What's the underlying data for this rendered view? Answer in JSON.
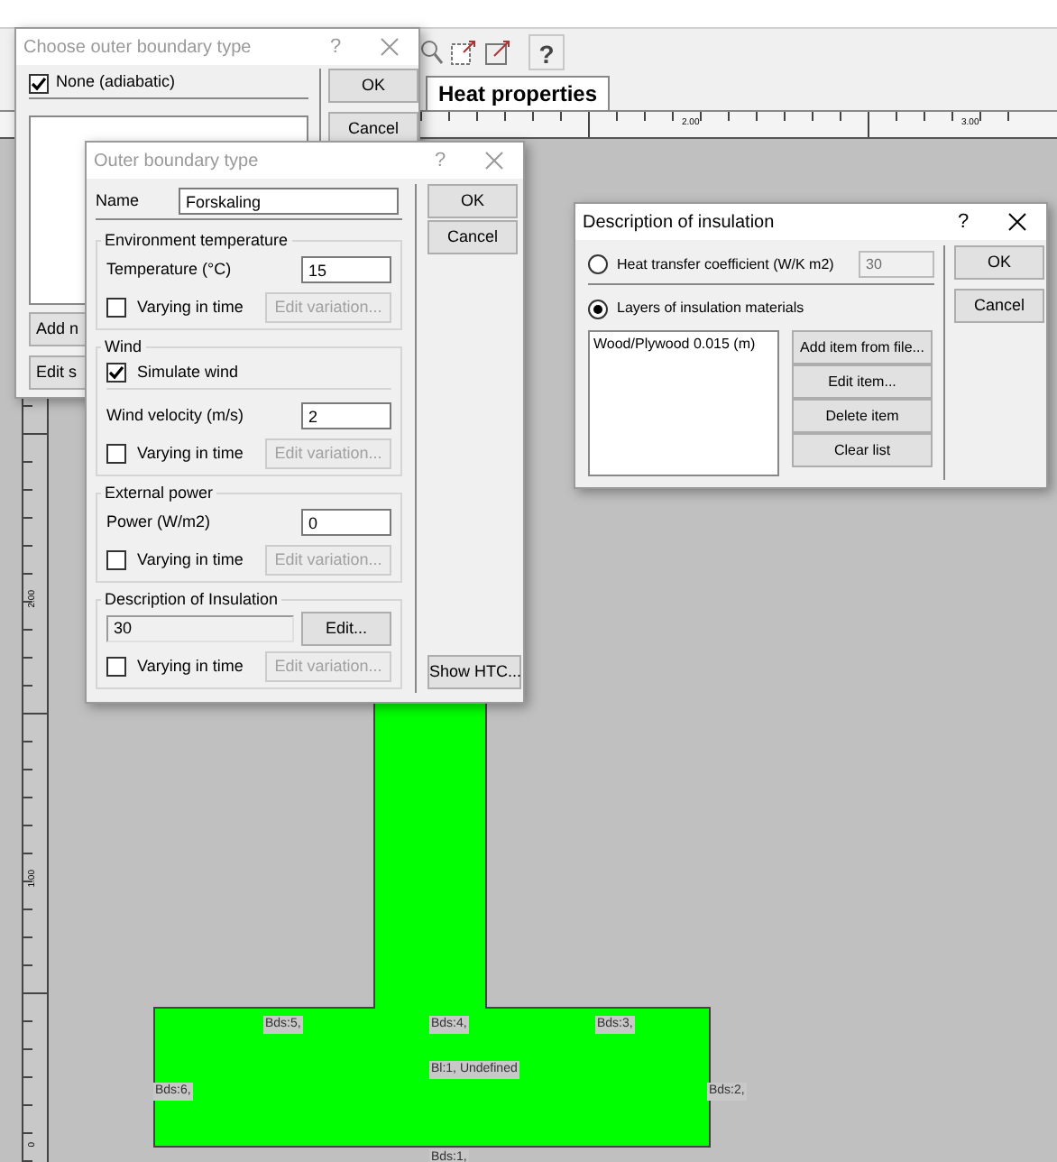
{
  "toolbar": {
    "help_button": "?"
  },
  "tabs": [
    {
      "label": "Heat properties",
      "selected": true
    }
  ],
  "horizontal_ruler": {
    "labels": [
      "2.00",
      "3.00"
    ]
  },
  "vertical_ruler": {
    "labels": [
      "2.00",
      "1.00",
      "0"
    ]
  },
  "geometry": {
    "labels": [
      {
        "text": "Bds:5,"
      },
      {
        "text": "Bds:4,"
      },
      {
        "text": "Bds:3,"
      },
      {
        "text": "Bl:1, Undefined"
      },
      {
        "text": "Bds:6,"
      },
      {
        "text": "Bds:2,"
      },
      {
        "text": "Bds:1,"
      }
    ]
  },
  "choose_dialog": {
    "title": "Choose outer boundary type",
    "help": "?",
    "active": false,
    "option": {
      "label": "None (adiabatic)",
      "checked": true
    },
    "buttons": [
      "OK",
      "Cancel"
    ],
    "bottom_buttons": [
      "Add n",
      "Edit s"
    ]
  },
  "outer_dialog": {
    "title": "Outer boundary type",
    "help": "?",
    "active": false,
    "name": {
      "label": "Name",
      "value": "Forskaling"
    },
    "groups": [
      {
        "title": "Environment temperature",
        "rows": [
          {
            "kind": "field",
            "label": "Temperature (°C)",
            "value": "15"
          },
          {
            "kind": "varying",
            "label": "Varying in time",
            "checked": false,
            "button": "Edit variation...",
            "disabled": true
          }
        ]
      },
      {
        "title": "Wind",
        "rows": [
          {
            "kind": "checkbox",
            "label": "Simulate wind",
            "checked": true
          },
          {
            "kind": "field",
            "label": "Wind velocity (m/s)",
            "value": "2"
          },
          {
            "kind": "varying",
            "label": "Varying in time",
            "checked": false,
            "button": "Edit variation...",
            "disabled": true
          }
        ]
      },
      {
        "title": "External power",
        "rows": [
          {
            "kind": "field",
            "label": "Power (W/m2)",
            "value": "0"
          },
          {
            "kind": "varying",
            "label": "Varying in time",
            "checked": false,
            "button": "Edit variation...",
            "disabled": true
          }
        ]
      },
      {
        "title": "Description of Insulation",
        "rows": [
          {
            "kind": "readout",
            "value": "30",
            "button": "Edit..."
          },
          {
            "kind": "varying",
            "label": "Varying in time",
            "checked": false,
            "button": "Edit variation...",
            "disabled": true
          }
        ]
      }
    ],
    "buttons": [
      "OK",
      "Cancel"
    ],
    "bottom_button": "Show HTC..."
  },
  "insulation_dialog": {
    "title": "Description of insulation",
    "help": "?",
    "active": true,
    "options": [
      {
        "label": "Heat transfer coefficient (W/K m2)",
        "selected": false,
        "value": "30"
      },
      {
        "label": "Layers of insulation materials",
        "selected": true
      }
    ],
    "list": [
      "Wood/Plywood 0.015 (m)"
    ],
    "list_buttons": [
      "Add item from file...",
      "Edit item...",
      "Delete item",
      "Clear list"
    ],
    "buttons": [
      "OK",
      "Cancel"
    ]
  }
}
